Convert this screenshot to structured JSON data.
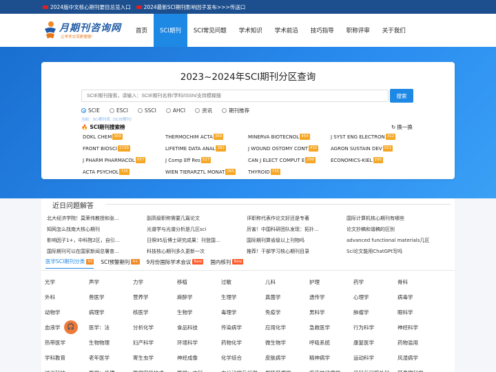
{
  "topbar": {
    "items": [
      {
        "label": "2024版中文核心期刊要目总览入口"
      },
      {
        "label": "2024最新SCI期刊影响因子发布>>>传送口"
      }
    ]
  },
  "logo": {
    "title": "月期刊咨询网",
    "slogan": "让学术交流更便捷!"
  },
  "nav": {
    "items": [
      {
        "label": "首页",
        "active": false
      },
      {
        "label": "SCI期刊",
        "active": true
      },
      {
        "label": "SCI常见问题",
        "active": false
      },
      {
        "label": "学术知识",
        "active": false
      },
      {
        "label": "学术前沿",
        "active": false
      },
      {
        "label": "技巧指导",
        "active": false
      },
      {
        "label": "职称评审",
        "active": false
      },
      {
        "label": "关于我们",
        "active": false
      }
    ]
  },
  "search": {
    "title": "2023~2024年SCI期刊分区查询",
    "placeholder": "SCIE期刊搜索，请输入：SCIE期刊名称/学科/ISSN/支持模糊搜",
    "button": "搜索",
    "options": [
      {
        "label": "SCIE",
        "checked": true
      },
      {
        "label": "ESCI",
        "checked": false
      },
      {
        "label": "SSCI",
        "checked": false
      },
      {
        "label": "AHCI",
        "checked": false
      },
      {
        "label": "资讯",
        "checked": false
      },
      {
        "label": "期刊推荐",
        "checked": false
      }
    ],
    "hint": "当前：SCI期刊库（SCIE期刊）"
  },
  "ranking": {
    "title": "SCI期刊搜索榜",
    "refresh": "换一换",
    "journals": [
      {
        "name": "DOKL CHEM",
        "count": "369"
      },
      {
        "name": "THERMOCHIM ACTA",
        "count": "369"
      },
      {
        "name": "MINERVA BIOTECNOL",
        "count": "454"
      },
      {
        "name": "J SYST ENG ELECTRON",
        "count": "312"
      },
      {
        "name": "FRONT BIOSCI",
        "count": "1720"
      },
      {
        "name": "LIFETIME DATA ANAL",
        "count": "382"
      },
      {
        "name": "J WOUND OSTOMY CONT",
        "count": "432"
      },
      {
        "name": "AGRON SUSTAIN DEV",
        "count": "551"
      },
      {
        "name": "J PHARM PHARMACOL",
        "count": "657"
      },
      {
        "name": "J Comp Eff Res",
        "count": "517"
      },
      {
        "name": "CAN J ELECT COMPUT E",
        "count": "299"
      },
      {
        "name": "ECONOMICS-KIEL",
        "count": "295"
      },
      {
        "name": "ACTA PSYCHOL",
        "count": "735"
      },
      {
        "name": "WIEN TIERARZTL MONAT",
        "count": "285"
      },
      {
        "name": "THYROID",
        "count": "735"
      }
    ]
  },
  "faq": {
    "title": "近日问题解答",
    "items": [
      "北大经济学院！莫荣伟教授和张...",
      "副高级职称需要几篇论文",
      "评职称代表作论文好还是专著",
      "国际计算机核心期刊有哪些",
      "知网怎么找南大核心期刊",
      "光谱学与光谱分析是几区sci",
      "厉害！中国科研团队发现：拓扑...",
      "论文抄稿和谐稿的区别",
      "影响因子1+，中科院2区，自引...",
      "日照95后博士研究成果：刊登国...",
      "国际期刊算省级以上刊物吗",
      "advanced functional materials几区",
      "国际期刊可以在国家新闻总署查...",
      "科技核心期刊多久更新一次",
      "推荐！干部学习核心期刊目录",
      "Sci论文能用ChatGPt写吗"
    ]
  },
  "tabs": [
    {
      "label": "医学SCI期刊分类",
      "badge": "93",
      "badge_type": "count",
      "active": true
    },
    {
      "label": "SCI预警期刊",
      "badge": "4+",
      "badge_type": "count",
      "active": false
    },
    {
      "label": "9月份国际学术会议",
      "badge": "New",
      "badge_type": "new",
      "active": false
    },
    {
      "label": "国内核刊",
      "badge": "New",
      "badge_type": "new",
      "active": false
    }
  ],
  "categories": [
    "光学",
    "声学",
    "力学",
    "移植",
    "过敏",
    "儿科",
    "护理",
    "药学",
    "骨科",
    "外科",
    "兽医学",
    "营养学",
    "麻醉学",
    "生理学",
    "真菌学",
    "遗传学",
    "心理学",
    "病毒学",
    "动物学",
    "病理学",
    "核医学",
    "生物学",
    "毒理学",
    "免疫学",
    "男科学",
    "肿瘤学",
    "眼科学",
    "血液学",
    "医学：法",
    "分析化学",
    "食品科技",
    "传染病学",
    "应用化学",
    "急救医学",
    "行为科学",
    "神经科学",
    "热带医学",
    "生物物理",
    "妇产科学",
    "环境科学",
    "药物化学",
    "微生物学",
    "呼吸系统",
    "康复医学",
    "药物滥用",
    "学科教育",
    "老年医学",
    "寄生虫学",
    "神经成像",
    "化学综合",
    "皮肤病学",
    "精神病学",
    "运动科学",
    "风湿病学",
    "纳米科技",
    "医学：伦理",
    "医学实验技术",
    "医学：内科",
    "内分泌学与代谢",
    "胃肠肝病学",
    "临床神经病学",
    "牙科与口腔外科",
    "耳鼻喉科学"
  ]
}
